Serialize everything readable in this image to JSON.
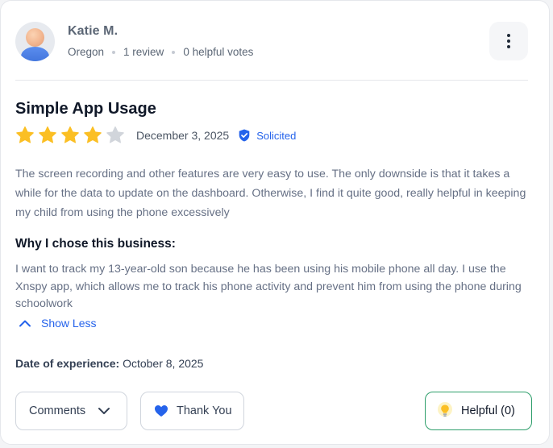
{
  "reviewer": {
    "name": "Katie M.",
    "location": "Oregon",
    "reviews": "1 review",
    "helpful_votes": "0 helpful votes"
  },
  "review": {
    "title": "Simple App Usage",
    "rating": 4,
    "max_rating": 5,
    "date": "December 3, 2025",
    "badge": "Solicited",
    "body": "The screen recording and other features are very easy to use. The only downside is that it takes a while for the data to update on the dashboard. Otherwise, I find it quite good, really helpful in keeping my child from using the phone excessively",
    "why_title": "Why I chose this business:",
    "why_body": "I want to track my 13-year-old son because he has been using his mobile phone all day. I use the Xnspy app, which allows me to track his phone activity and prevent him from using the phone during schoolwork",
    "show_less_label": "Show Less",
    "experience_label": "Date of experience:",
    "experience_date": "October 8, 2025"
  },
  "actions": {
    "comments_label": "Comments",
    "thank_you_label": "Thank You",
    "helpful_label": "Helpful (0)"
  },
  "colors": {
    "star_filled": "#fbbf24",
    "star_empty": "#d1d5db",
    "accent_blue": "#2563eb",
    "helpful_border": "#2e9e6b"
  },
  "icons": {
    "more": "more-vertical-icon",
    "badge": "shield-check-icon",
    "show_less": "chevron-up-icon",
    "comments": "chevron-down-icon",
    "thank_you": "heart-icon",
    "helpful": "lightbulb-icon"
  }
}
